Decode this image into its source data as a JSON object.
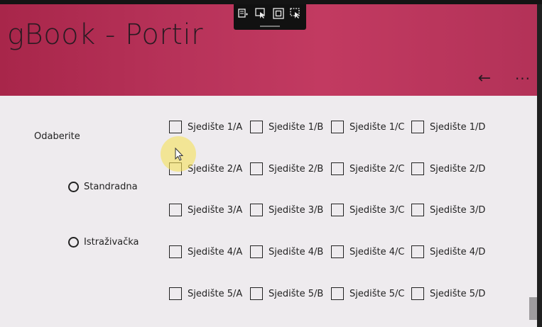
{
  "app": {
    "title": "gBook - Portir"
  },
  "header": {
    "back_glyph": "←",
    "more_glyph": "···"
  },
  "selection": {
    "label": "Odaberite"
  },
  "radios": [
    {
      "label": "Standradna",
      "selected": false
    },
    {
      "label": "Istraživačka",
      "selected": false
    }
  ],
  "seats": {
    "rows": [
      [
        "Sjedište 1/A",
        "Sjedište 1/B",
        "Sjedište 1/C",
        "Sjedište 1/D"
      ],
      [
        "Sjedište 2/A",
        "Sjedište 2/B",
        "Sjedište 2/C",
        "Sjedište 2/D"
      ],
      [
        "Sjedište 3/A",
        "Sjedište 3/B",
        "Sjedište 3/C",
        "Sjedište 3/D"
      ],
      [
        "Sjedište 4/A",
        "Sjedište 4/B",
        "Sjedište 4/C",
        "Sjedište 4/D"
      ],
      [
        "Sjedište 5/A",
        "Sjedište 5/B",
        "Sjedište 5/C",
        "Sjedište 5/D"
      ]
    ]
  },
  "colors": {
    "header_accent": "#b8335a",
    "content_bg": "#eeebee"
  },
  "debug_toolbar": {
    "icons": [
      "live-visual-tree-icon",
      "select-element-icon",
      "display-layout-adorners-icon",
      "track-focus-icon"
    ]
  }
}
